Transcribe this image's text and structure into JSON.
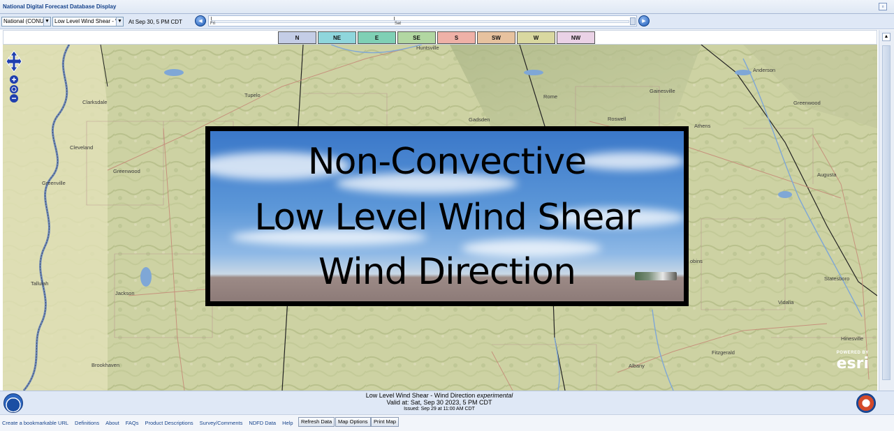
{
  "window": {
    "title": "National Digital Forecast Database Display",
    "restore_icon": "restore-window-icon"
  },
  "controls": {
    "region_select": "National (CONUS",
    "product_select": "Low Level Wind Shear - W",
    "valid_time": "At Sep 30,    5 PM CDT",
    "timeline": {
      "day_labels": [
        "Fri",
        "Sat"
      ]
    }
  },
  "legend": {
    "items": [
      {
        "label": "N",
        "color": "#c4cde6"
      },
      {
        "label": "NE",
        "color": "#8fd6dc"
      },
      {
        "label": "E",
        "color": "#7fd0b5"
      },
      {
        "label": "SE",
        "color": "#b2d7a2"
      },
      {
        "label": "S",
        "color": "#efb1a7"
      },
      {
        "label": "SW",
        "color": "#e7c29f"
      },
      {
        "label": "W",
        "color": "#d9d8a0"
      },
      {
        "label": "NW",
        "color": "#ead2e6"
      }
    ]
  },
  "map": {
    "cities": [
      {
        "name": "Huntsville"
      },
      {
        "name": "Tupelo"
      },
      {
        "name": "Clarksdale"
      },
      {
        "name": "Cleveland"
      },
      {
        "name": "Greenwood"
      },
      {
        "name": "Greenville"
      },
      {
        "name": "Tallulah"
      },
      {
        "name": "Jackson"
      },
      {
        "name": "Brookhaven"
      },
      {
        "name": "Gadsden"
      },
      {
        "name": "Rome"
      },
      {
        "name": "Roswell"
      },
      {
        "name": "Gainesville"
      },
      {
        "name": "Athens"
      },
      {
        "name": "Anderson"
      },
      {
        "name": "Greenwood"
      },
      {
        "name": "Augusta"
      },
      {
        "name": "Statesboro"
      },
      {
        "name": "Vidalia"
      },
      {
        "name": "Hinesville"
      },
      {
        "name": "Fitzgerald"
      },
      {
        "name": "Albany"
      },
      {
        "name": "obins"
      }
    ],
    "esri": {
      "powered": "POWERED BY",
      "brand": "esri"
    }
  },
  "overlay": {
    "line1": "Non-Convective",
    "line2": "Low Level Wind Shear",
    "line3": "Wind Direction"
  },
  "info": {
    "product": "Low Level Wind Shear - Wind Direction",
    "product_note": "experimental",
    "valid": "Valid at: Sat, Sep 30 2023,    5 PM CDT",
    "issued": "Issued: Sep 29 at 11:00 AM CDT"
  },
  "links": [
    "Create a bookmarkable URL",
    "Definitions",
    "About",
    "FAQs",
    "Product Descriptions",
    "Survey/Comments",
    "NDFD Data",
    "Help"
  ],
  "buttons": {
    "refresh": "Refresh Data",
    "map_options": "Map Options",
    "print_map": "Print Map"
  }
}
